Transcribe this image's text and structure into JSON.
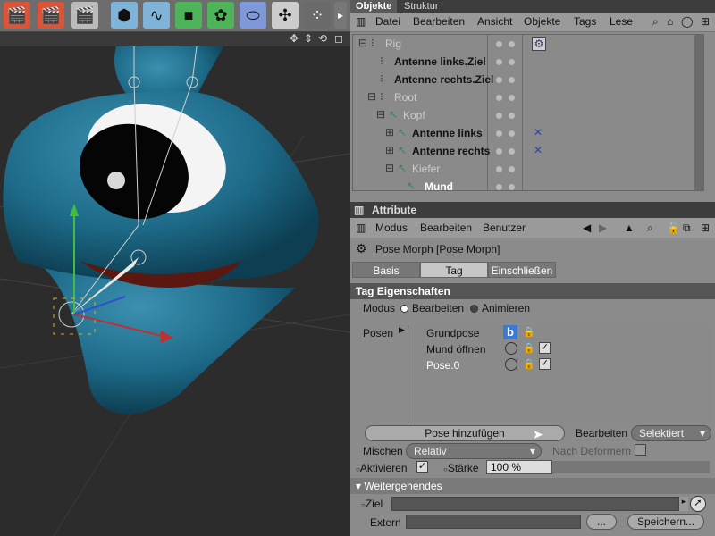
{
  "right_tabs": {
    "objects": "Objekte",
    "structure": "Struktur"
  },
  "objects_menu": [
    "Datei",
    "Bearbeiten",
    "Ansicht",
    "Objekte",
    "Tags",
    "Lese"
  ],
  "objects_tree": [
    {
      "name": "Rig",
      "grey": true
    },
    {
      "name": "Antenne links.Ziel",
      "grey": false
    },
    {
      "name": "Antenne rechts.Ziel",
      "grey": false
    },
    {
      "name": "Root",
      "grey": true
    },
    {
      "name": "Kopf",
      "grey": true
    },
    {
      "name": "Antenne links",
      "grey": false
    },
    {
      "name": "Antenne rechts",
      "grey": false
    },
    {
      "name": "Kiefer",
      "grey": true
    },
    {
      "name": "Mund",
      "grey": false
    }
  ],
  "attr": {
    "header": "Attribute",
    "menu": [
      "Modus",
      "Bearbeiten",
      "Benutzer"
    ],
    "title": "Pose Morph [Pose Morph]",
    "tabs": [
      "Basis",
      "Tag",
      "Einschließen"
    ],
    "active_tab": "Tag",
    "section": "Tag Eigenschaften",
    "mode_label": "Modus",
    "mode_edit": "Bearbeiten",
    "mode_animate": "Animieren",
    "poses_label": "Posen",
    "poses": [
      "Grundpose",
      "Mund öffnen",
      "Pose.0"
    ],
    "add_pose": "Pose hinzufügen",
    "edit_label": "Bearbeiten",
    "edit_value": "Selektiert",
    "mix_label": "Mischen",
    "mix_value": "Relativ",
    "after_deformers": "Nach Deformern",
    "activate_label": "Aktivieren",
    "strength_label": "Stärke",
    "strength_value": "100 %",
    "advanced": "Weitergehendes",
    "target_label": "Ziel",
    "extern_label": "Extern",
    "dots": "...",
    "save": "Speichern..."
  }
}
